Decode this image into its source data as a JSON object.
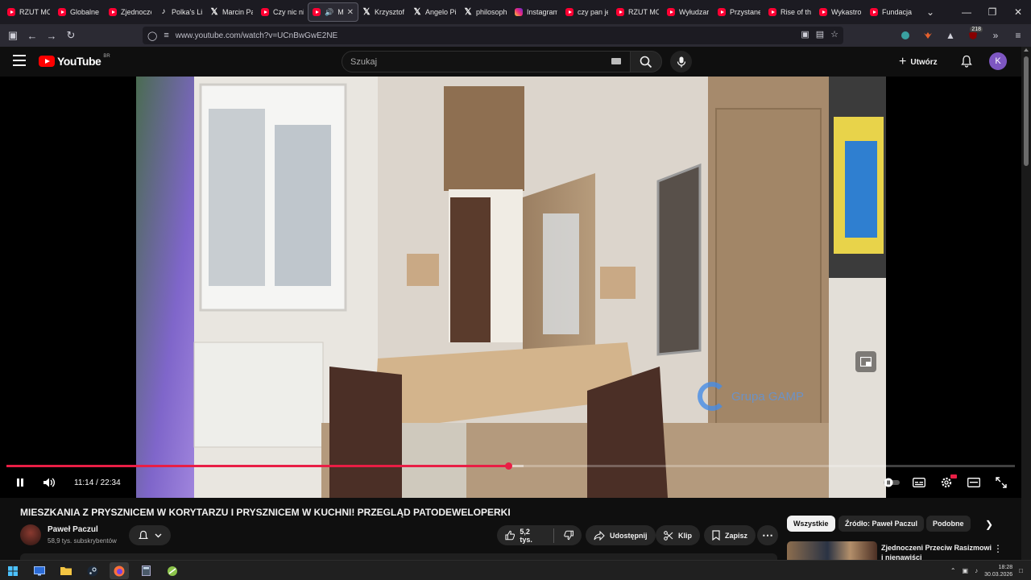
{
  "browser": {
    "tabs": [
      {
        "title": "RZUT MOŻ",
        "favicon": "youtube-icon",
        "active": false
      },
      {
        "title": "Globalne",
        "favicon": "youtube-icon",
        "active": false
      },
      {
        "title": "Zjednocze",
        "favicon": "youtube-icon",
        "active": false
      },
      {
        "title": "Polka's Lif",
        "favicon": "tiktok-icon",
        "active": false
      },
      {
        "title": "Marcin Pa",
        "favicon": "x-icon",
        "active": false
      },
      {
        "title": "Czy nic ni",
        "favicon": "youtube-icon",
        "active": false
      },
      {
        "title": "MIE",
        "favicon": "youtube-icon",
        "active": true,
        "playing": true
      },
      {
        "title": "Krzysztof",
        "favicon": "x-icon",
        "active": false
      },
      {
        "title": "Angelo Pi",
        "favicon": "x-icon",
        "active": false
      },
      {
        "title": "philosoph",
        "favicon": "x-icon",
        "active": false
      },
      {
        "title": "Instagram",
        "favicon": "instagram-icon",
        "active": false
      },
      {
        "title": "czy pan je",
        "favicon": "youtube-icon",
        "active": false
      },
      {
        "title": "RZUT MO",
        "favicon": "youtube-icon",
        "active": false
      },
      {
        "title": "Wyłudzar",
        "favicon": "youtube-icon",
        "active": false
      },
      {
        "title": "Przystane",
        "favicon": "youtube-icon",
        "active": false
      },
      {
        "title": "Rise of th",
        "favicon": "youtube-icon",
        "active": false
      },
      {
        "title": "Wykastro",
        "favicon": "youtube-icon",
        "active": false
      },
      {
        "title": "Fundacja",
        "favicon": "youtube-icon",
        "active": false
      }
    ],
    "url": "www.youtube.com/watch?v=UCnBwGwE2NE",
    "extension_badge": "218"
  },
  "youtube": {
    "logo_text": "YouTube",
    "region": "BR",
    "search_placeholder": "Szukaj",
    "create_label": "Utwórz",
    "avatar_letter": "K"
  },
  "player": {
    "current_time": "11:14",
    "duration": "22:34",
    "time_display": "11:14 / 22:34",
    "played_fraction": 0.498,
    "buffered_fraction": 0.513,
    "watermark_text": "Grupa GAMP",
    "accent_color": "#e91e45"
  },
  "video": {
    "title": "MIESZKANIA Z PRYSZNICEM W KORYTARZU I PRYSZNICEM W KUCHNI! PRZEGLĄD PATODEWELOPERKI",
    "channel_name": "Paweł Paczul",
    "subscribers": "58,9 tys. subskrybentów",
    "likes": "5,2 tys.",
    "share_label": "Udostępnij",
    "clip_label": "Klip",
    "save_label": "Zapisz"
  },
  "sidebar": {
    "chips": [
      "Wszystkie",
      "Źródło: Paweł Paczul",
      "Podobne"
    ],
    "recommendation_title": "Zjednoczeni Przeciw Rasizmowi i nienawiści"
  },
  "taskbar": {
    "time": "18:28",
    "date": "30.03.2026"
  }
}
